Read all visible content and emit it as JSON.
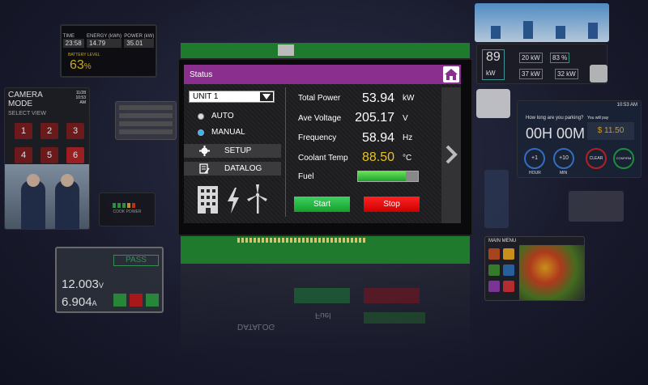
{
  "thumbs": {
    "ev": {
      "labels": [
        "TIME",
        "ENERGY (kWh)",
        "POWER (kW)"
      ],
      "values": [
        "23:58",
        "14.79",
        "35.01"
      ],
      "battery_label": "BATTERY LEVEL",
      "battery_value": "63",
      "battery_unit": "%"
    },
    "camera": {
      "title": "CAMERA MODE",
      "date": "11/28",
      "time": "10:53 AM",
      "select": "SELECT VIEW",
      "views": [
        "1",
        "2",
        "3",
        "4",
        "5",
        "6"
      ]
    },
    "cook": {
      "label": "COOK POWER"
    },
    "test": {
      "result": "PASS",
      "value1": "12.003",
      "unit1": "V",
      "value2": "6.904",
      "unit2": "A"
    },
    "energy": {
      "main_value": "89",
      "main_unit": "kW",
      "v1": "20",
      "u1": "kW",
      "v2": "83",
      "u2": "%",
      "v3": "37",
      "u3": "kW",
      "v4": "32",
      "u4": "kW"
    },
    "parking": {
      "time": "10:53 AM",
      "question": "How long are you parking?",
      "duration": "00H 00M",
      "pay_label": "You will pay",
      "pay_value": "$ 11.50",
      "btn1": "+1",
      "btn1_sub": "HOUR",
      "btn2": "+10",
      "btn2_sub": "MIN",
      "btn3": "CLEAR",
      "btn4": "CONFIRM"
    },
    "menu": {
      "title": "MAIN MENU"
    }
  },
  "header": {
    "title": "Status"
  },
  "unit_select": {
    "value": "UNIT 1"
  },
  "mode": {
    "auto_label": "AUTO",
    "manual_label": "MANUAL",
    "selected": "MANUAL"
  },
  "menu_buttons": {
    "setup": "SETUP",
    "datalog": "DATALOG"
  },
  "stats": {
    "total_power": {
      "label": "Total Power",
      "value": "53.94",
      "unit": "kW"
    },
    "ave_voltage": {
      "label": "Ave Voltage",
      "value": "205.17",
      "unit": "V"
    },
    "frequency": {
      "label": "Frequency",
      "value": "58.94",
      "unit": "Hz"
    },
    "coolant_temp": {
      "label": "Coolant Temp",
      "value": "88.50",
      "unit": "°C"
    },
    "fuel": {
      "label": "Fuel",
      "level": 0.8
    }
  },
  "buttons": {
    "start": "Start",
    "stop": "Stop"
  },
  "colors": {
    "header": "#8a2f8e",
    "accent": "#e8c21f",
    "start": "#1fb23a",
    "stop": "#e01010"
  }
}
